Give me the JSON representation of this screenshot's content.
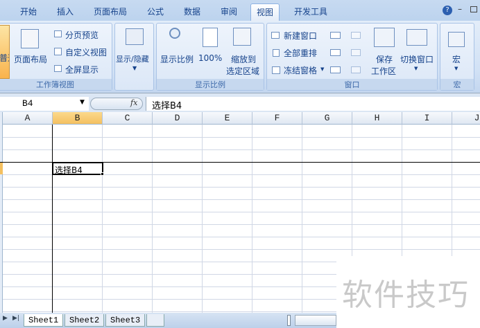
{
  "ribbon_tabs": [
    "开始",
    "插入",
    "页面布局",
    "公式",
    "数据",
    "审阅",
    "视图",
    "开发工具"
  ],
  "active_tab": "视图",
  "groups": {
    "workbook_views": {
      "label": "工作簿视图",
      "normal": "普通",
      "page_layout": "页面布局",
      "page_break": "分页预览",
      "custom_views": "自定义视图",
      "full_screen": "全屏显示"
    },
    "show_hide": {
      "label": "显示/隐藏"
    },
    "zoom": {
      "label": "显示比例",
      "zoom": "显示比例",
      "hundred": "100%",
      "zoom_sel_1": "缩放到",
      "zoom_sel_2": "选定区域"
    },
    "window": {
      "label": "窗口",
      "new_window": "新建窗口",
      "arrange_all": "全部重排",
      "freeze": "冻结窗格",
      "save_ws_1": "保存",
      "save_ws_2": "工作区",
      "switch": "切换窗口"
    },
    "macros": {
      "label": "宏",
      "macros": "宏"
    }
  },
  "formula_bar": {
    "name_box": "B4",
    "fx": "fx",
    "formula": "选择B4"
  },
  "columns": [
    "A",
    "B",
    "C",
    "D",
    "E",
    "F",
    "G",
    "H",
    "I",
    "J"
  ],
  "selected_column": "B",
  "cells": {
    "B4": "选择B4"
  },
  "sheets": [
    "Sheet1",
    "Sheet2",
    "Sheet3"
  ],
  "active_sheet": "Sheet1",
  "watermark": "软件技巧"
}
